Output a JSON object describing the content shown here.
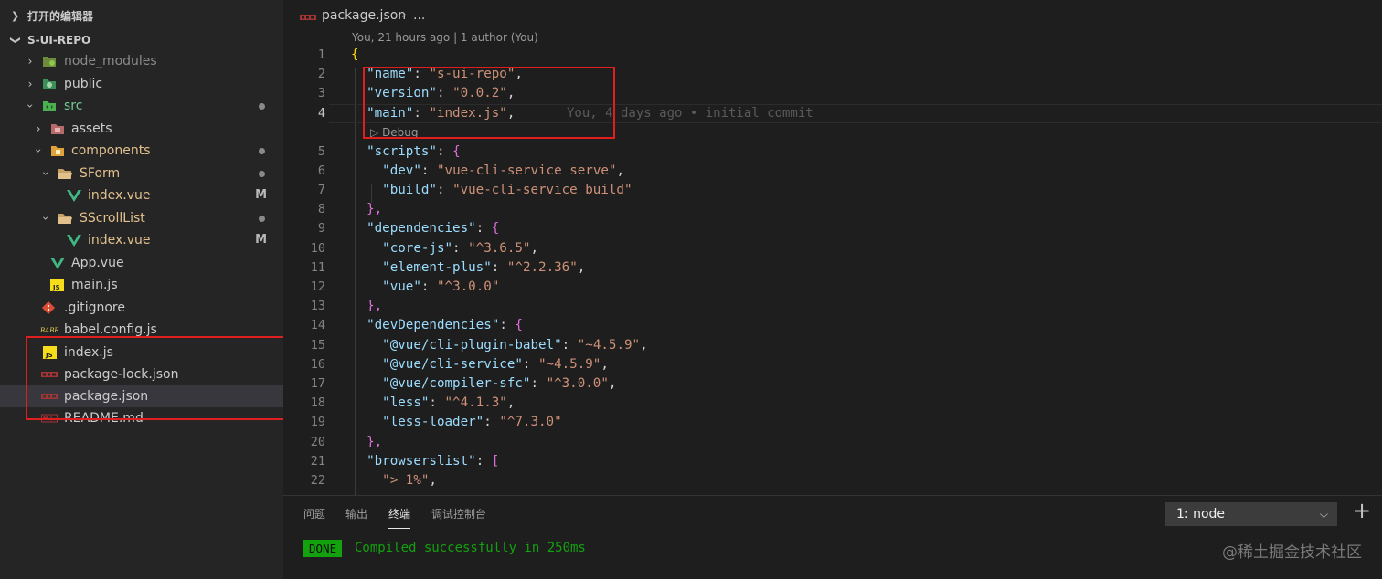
{
  "sidebar": {
    "open_editors": "打开的编辑器",
    "project": "S-UI-REPO",
    "items": [
      {
        "label": "node_modules",
        "color": "#8b8b8b"
      },
      {
        "label": "public",
        "color": "#cccccc"
      },
      {
        "label": "src",
        "color": "#73c991"
      },
      {
        "label": "assets",
        "color": "#cccccc"
      },
      {
        "label": "components",
        "color": "#e2c08d"
      },
      {
        "label": "SForm",
        "color": "#e2c08d"
      },
      {
        "label": "index.vue",
        "color": "#e2c08d",
        "badge": "M"
      },
      {
        "label": "SScrollList",
        "color": "#e2c08d"
      },
      {
        "label": "index.vue",
        "color": "#e2c08d",
        "badge": "M"
      },
      {
        "label": "App.vue",
        "color": "#cccccc"
      },
      {
        "label": "main.js",
        "color": "#cccccc"
      },
      {
        "label": ".gitignore",
        "color": "#cccccc"
      },
      {
        "label": "babel.config.js",
        "color": "#cccccc"
      },
      {
        "label": "index.js",
        "color": "#cccccc"
      },
      {
        "label": "package-lock.json",
        "color": "#cccccc"
      },
      {
        "label": "package.json",
        "color": "#cccccc"
      },
      {
        "label": "README.md",
        "color": "#cccccc"
      }
    ]
  },
  "editor": {
    "breadcrumb_file": "package.json",
    "breadcrumb_more": "...",
    "codelens_author": "You, 21 hours ago | 1 author (You)",
    "codelens_debug": "Debug",
    "blame": "You, 4 days ago • initial commit",
    "line_numbers": [
      "1",
      "2",
      "3",
      "4",
      "5",
      "6",
      "7",
      "8",
      "9",
      "10",
      "11",
      "12",
      "13",
      "14",
      "15",
      "16",
      "17",
      "18",
      "19",
      "20",
      "21",
      "22"
    ],
    "lines": [
      {
        "p0": "{"
      },
      {
        "k": "\"name\"",
        "p": ": ",
        "s": "\"s-ui-repo\"",
        "e": ","
      },
      {
        "k": "\"version\"",
        "p": ": ",
        "s": "\"0.0.2\"",
        "e": ","
      },
      {
        "k": "\"main\"",
        "p": ": ",
        "s": "\"index.js\"",
        "e": ","
      },
      {
        "k": "\"scripts\"",
        "p": ": ",
        "b": "{"
      },
      {
        "k": "\"dev\"",
        "p": ": ",
        "s": "\"vue-cli-service serve\"",
        "e": ","
      },
      {
        "k": "\"build\"",
        "p": ": ",
        "s": "\"vue-cli-service build\""
      },
      {
        "b": "},"
      },
      {
        "k": "\"dependencies\"",
        "p": ": ",
        "b": "{"
      },
      {
        "k": "\"core-js\"",
        "p": ": ",
        "s": "\"^3.6.5\"",
        "e": ","
      },
      {
        "k": "\"element-plus\"",
        "p": ": ",
        "s": "\"^2.2.36\"",
        "e": ","
      },
      {
        "k": "\"vue\"",
        "p": ": ",
        "s": "\"^3.0.0\""
      },
      {
        "b": "},"
      },
      {
        "k": "\"devDependencies\"",
        "p": ": ",
        "b": "{"
      },
      {
        "k": "\"@vue/cli-plugin-babel\"",
        "p": ": ",
        "s": "\"~4.5.9\"",
        "e": ","
      },
      {
        "k": "\"@vue/cli-service\"",
        "p": ": ",
        "s": "\"~4.5.9\"",
        "e": ","
      },
      {
        "k": "\"@vue/compiler-sfc\"",
        "p": ": ",
        "s": "\"^3.0.0\"",
        "e": ","
      },
      {
        "k": "\"less\"",
        "p": ": ",
        "s": "\"^4.1.3\"",
        "e": ","
      },
      {
        "k": "\"less-loader\"",
        "p": ": ",
        "s": "\"^7.3.0\""
      },
      {
        "b": "},"
      },
      {
        "k": "\"browserslist\"",
        "p": ": ",
        "b": "["
      },
      {
        "s": "\"> 1%\"",
        "e": ","
      }
    ]
  },
  "panel": {
    "tabs": [
      "问题",
      "输出",
      "终端",
      "调试控制台"
    ],
    "terminal_select": "1: node",
    "done": "DONE",
    "message": "Compiled successfully in 250ms"
  },
  "watermark": "@稀土掘金技术社区"
}
